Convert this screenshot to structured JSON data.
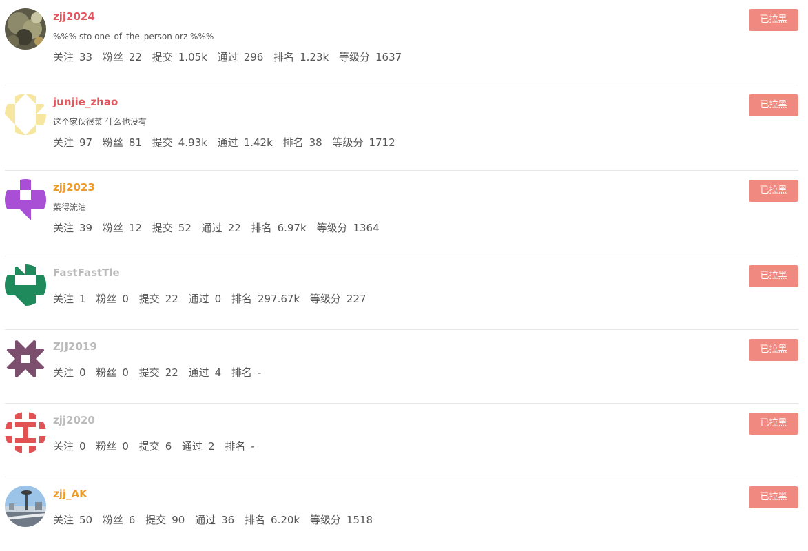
{
  "colors": {
    "name_red": "#e0565d",
    "name_orange": "#eb9c2c",
    "name_gray": "#bbbbbb",
    "button_bg": "#f08a80"
  },
  "stat_labels": {
    "follow": "关注",
    "fans": "粉丝",
    "submit": "提交",
    "pass": "通过",
    "rank": "排名",
    "score": "等级分"
  },
  "users": [
    {
      "name": "zjj2024",
      "name_color": "red",
      "bio": "%%% sto one_of_the_person orz %%%",
      "follow": "33",
      "fans": "22",
      "submit": "1.05k",
      "pass": "296",
      "rank": "1.23k",
      "score": "1637",
      "button": "已拉黑",
      "avatar": "photo-rock-avatar"
    },
    {
      "name": "junjie_zhao",
      "name_color": "red",
      "bio": "这个家伙很菜 什么也没有",
      "follow": "97",
      "fans": "81",
      "submit": "4.93k",
      "pass": "1.42k",
      "rank": "38",
      "score": "1712",
      "button": "已拉黑",
      "avatar": "identicon-yellow"
    },
    {
      "name": "zjj2023",
      "name_color": "orange",
      "bio": "菜得流油",
      "follow": "39",
      "fans": "12",
      "submit": "52",
      "pass": "22",
      "rank": "6.97k",
      "score": "1364",
      "button": "已拉黑",
      "avatar": "identicon-purple"
    },
    {
      "name": "FastFastTle",
      "name_color": "gray",
      "bio": "",
      "follow": "1",
      "fans": "0",
      "submit": "22",
      "pass": "0",
      "rank": "297.67k",
      "score": "227",
      "button": "已拉黑",
      "avatar": "identicon-green"
    },
    {
      "name": "ZJJ2019",
      "name_color": "gray",
      "bio": "",
      "follow": "0",
      "fans": "0",
      "submit": "22",
      "pass": "4",
      "rank": "-",
      "score": "",
      "button": "已拉黑",
      "avatar": "identicon-mauve"
    },
    {
      "name": "zjj2020",
      "name_color": "gray",
      "bio": "",
      "follow": "0",
      "fans": "0",
      "submit": "6",
      "pass": "2",
      "rank": "-",
      "score": "",
      "button": "已拉黑",
      "avatar": "identicon-red"
    },
    {
      "name": "zjj_AK",
      "name_color": "orange",
      "bio": "",
      "follow": "50",
      "fans": "6",
      "submit": "90",
      "pass": "36",
      "rank": "6.20k",
      "score": "1518",
      "button": "已拉黑",
      "avatar": "photo-tower-avatar"
    }
  ]
}
